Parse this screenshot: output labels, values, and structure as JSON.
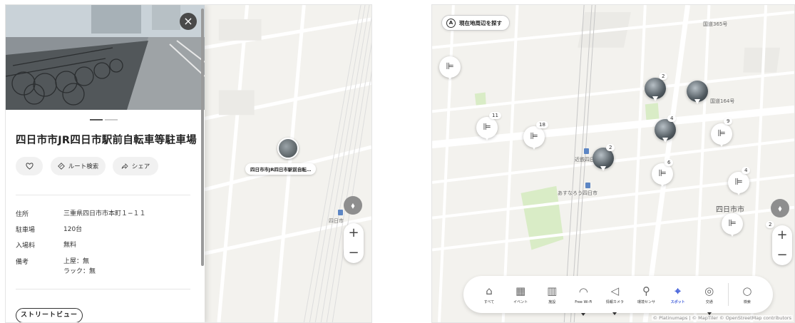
{
  "left_panel": {
    "close_label": "×",
    "title": "四日市市JR四日市駅前自転車等駐車場",
    "actions": {
      "favorite_icon": "heart-icon",
      "route_label": "ルート検索",
      "share_label": "シェア"
    },
    "info_rows": [
      {
        "key": "住所",
        "value": "三重県四日市市本町１−１１"
      },
      {
        "key": "駐車場",
        "value": "120台"
      },
      {
        "key": "入場料",
        "value": "無料"
      },
      {
        "key": "備考",
        "value": "上屋：無\nラック：無"
      }
    ],
    "street_view_label": "ストリートビュー"
  },
  "left_map": {
    "marker_label": "四日市市JR四日市駅前自転…",
    "station_label": "四日市",
    "zoom_in": "+",
    "zoom_out": "−"
  },
  "right_map": {
    "search_area_icon": "A",
    "search_area_label": "現在地周辺を探す",
    "labels": {
      "kintetsu": "近鉄四日",
      "asunarou": "あすなろう四日市",
      "yokkaichi": "四日市市",
      "road1": "国道365号",
      "road2": "国道164号"
    },
    "cluster_counts": [
      "11",
      "18",
      "2",
      "2",
      "4",
      "6",
      "9",
      "4",
      "2"
    ],
    "toolbar": [
      {
        "label": "すべて",
        "icon": "home-icon"
      },
      {
        "label": "イベント",
        "icon": "calendar-icon"
      },
      {
        "label": "施設",
        "icon": "building-icon"
      },
      {
        "label": "Free Wi-Fi",
        "icon": "wifi-icon"
      },
      {
        "label": "情報カメラ",
        "icon": "camera-icon"
      },
      {
        "label": "環境センサ",
        "icon": "sensor-icon"
      },
      {
        "label": "スポット",
        "icon": "spot-icon",
        "active": true
      },
      {
        "label": "交通",
        "icon": "train-icon"
      },
      {
        "label": "検索",
        "icon": "search-icon"
      }
    ],
    "zoom_in": "+",
    "zoom_out": "−",
    "attribution": "© Platinumaps | © MapTiler © OpenStreetMap contributors"
  },
  "colors": {
    "accent": "#3d5bd9",
    "map_bg": "#f3f2ee",
    "park": "#d9ecc6"
  }
}
